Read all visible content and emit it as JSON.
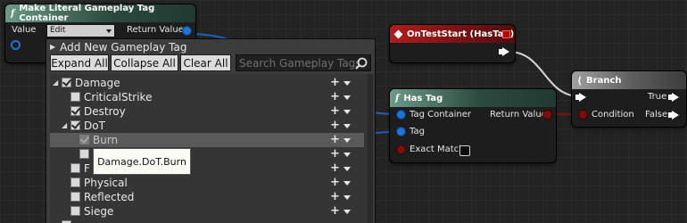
{
  "make_node": {
    "title": "Make Literal Gameplay Tag Container",
    "value_label": "Value",
    "value_dropdown": "Edit",
    "return_label": "Return Value"
  },
  "picker": {
    "title": "Add New Gameplay Tag",
    "expand_all": "Expand All",
    "collapse_all": "Collapse All",
    "clear_all": "Clear All",
    "search_placeholder": "Search Gameplay Tags",
    "rows": [
      {
        "label": "Damage",
        "checked": true,
        "expanded": true
      },
      {
        "label": "CriticalStrike",
        "checked": false
      },
      {
        "label": "Destroy",
        "checked": true
      },
      {
        "label": "DoT",
        "checked": true,
        "expanded": true
      },
      {
        "label": "Burn",
        "checked": true,
        "highlighted": true
      },
      {
        "label": "",
        "checked": false
      },
      {
        "label": "F",
        "checked": false
      },
      {
        "label": "Physical",
        "checked": false
      },
      {
        "label": "Reflected",
        "checked": false
      },
      {
        "label": "Siege",
        "checked": false
      }
    ],
    "tooltip": "Damage.DoT.Burn"
  },
  "on_test_start": {
    "title": "OnTestStart (HasTag)"
  },
  "has_tag": {
    "title": "Has Tag",
    "tag_container": "Tag Container",
    "tag": "Tag",
    "exact_match": "Exact Match",
    "return_value": "Return Value"
  },
  "branch": {
    "title": "Branch",
    "condition": "Condition",
    "true_label": "True",
    "false_label": "False"
  },
  "colors": {
    "function_header": "#2b4a3e",
    "event_header": "#7a1313",
    "branch_header": "#5c5c5c",
    "struct_pin": "#1f73d6",
    "bool_pin": "#7b0d0d"
  }
}
